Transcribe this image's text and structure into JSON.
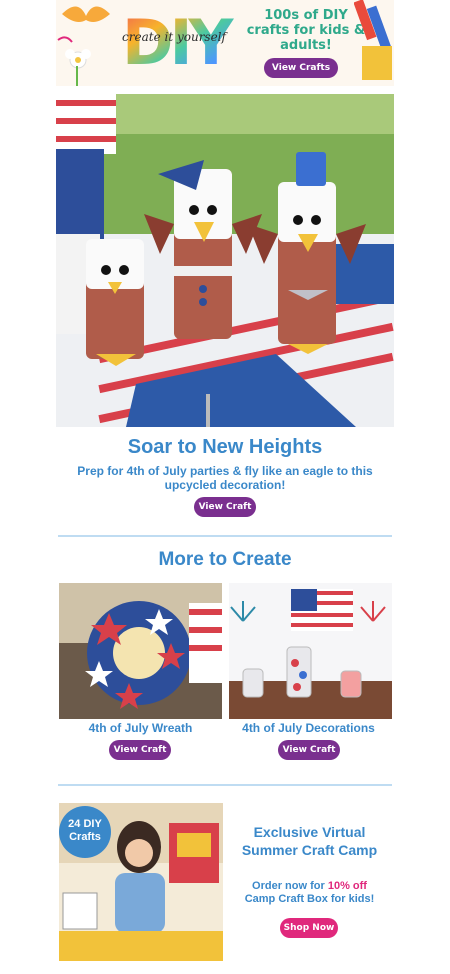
{
  "banner": {
    "logo_text": "create it yourself",
    "tagline": "100s of DIY crafts for kids & adults!",
    "button": "View Crafts"
  },
  "hero": {
    "title": "Soar to New Heights",
    "subtitle": "Prep for 4th of July parties & fly like an eagle to this upcycled decoration!",
    "button": "View Craft"
  },
  "more": {
    "title": "More to Create",
    "items": [
      {
        "caption": "4th of July Wreath",
        "button": "View Craft"
      },
      {
        "caption": "4th of July Decorations",
        "button": "View Craft"
      }
    ]
  },
  "camp": {
    "badge_line1": "24 DIY",
    "badge_line2": "Crafts",
    "title": "Exclusive Virtual Summer Craft Camp",
    "order_prefix": "Order now for ",
    "discount": "10% off",
    "order_suffix": "Camp Craft Box for kids!",
    "button": "Shop Now"
  },
  "colors": {
    "accent_blue": "#3a88c9",
    "button_purple": "#7a2f8f",
    "button_pink": "#e0287c",
    "tagline_teal": "#2fa98b"
  }
}
